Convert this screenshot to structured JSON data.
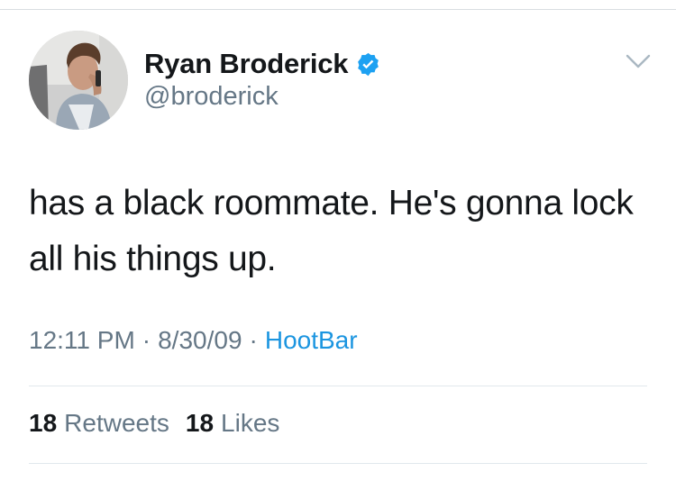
{
  "tweet": {
    "author": {
      "display_name": "Ryan Broderick",
      "handle": "@broderick",
      "verified": true,
      "avatar_icon": "profile-photo"
    },
    "text": "has a black roommate. He's gonna lock all his things up.",
    "time": "12:11 PM",
    "separator": "·",
    "date": "8/30/09",
    "source": "HootBar",
    "stats": {
      "retweets_count": "18",
      "retweets_label": "Retweets",
      "likes_count": "18",
      "likes_label": "Likes"
    },
    "icons": {
      "verified": "verified-badge-icon",
      "menu": "chevron-down-icon"
    },
    "colors": {
      "link": "#1b95e0",
      "verified": "#1da1f2",
      "secondary_text": "#657786",
      "primary_text": "#14171a"
    }
  }
}
